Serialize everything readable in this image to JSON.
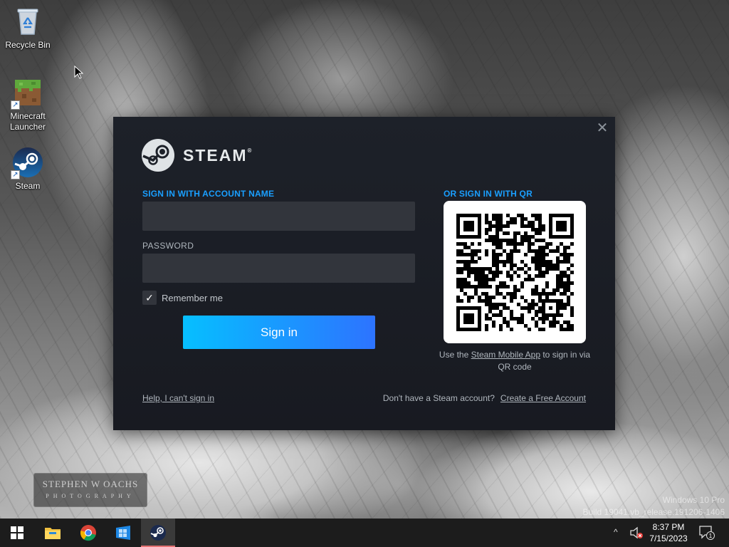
{
  "desktop": {
    "icons": [
      {
        "label": "Recycle Bin"
      },
      {
        "label": "Minecraft Launcher"
      },
      {
        "label": "Steam"
      }
    ],
    "photo_watermark": {
      "line1": "STEPHEN W OACHS",
      "line2": "PHOTOGRAPHY"
    },
    "windows_watermark": {
      "line1": "Windows 10 Pro",
      "line2": "Build 19041.vb_release.191206-1406"
    }
  },
  "steam_dialog": {
    "brand": "STEAM",
    "trademark": "®",
    "close_glyph": "✕",
    "account_label": "SIGN IN WITH ACCOUNT NAME",
    "account_value": "",
    "password_label": "PASSWORD",
    "password_value": "",
    "remember_label": "Remember me",
    "remember_checked": true,
    "signin_label": "Sign in",
    "qr_label": "OR SIGN IN WITH QR",
    "qr_caption_prefix": "Use the ",
    "qr_caption_link": "Steam Mobile App",
    "qr_caption_suffix": " to sign in via QR code",
    "help_link": "Help, I can't sign in",
    "no_account_text": "Don't have a Steam account?",
    "create_account_link": "Create a Free Account",
    "colors": {
      "accent": "#1a9fff",
      "button_start": "#06bfff",
      "button_end": "#2d73ff",
      "bg": "#181a21"
    }
  },
  "taskbar": {
    "items": [
      "start-icon",
      "file-explorer-icon",
      "chrome-icon",
      "windows-store-icon",
      "steam-icon"
    ],
    "active_item": "steam-icon",
    "tray_chevron": "^",
    "time": "8:37 PM",
    "date": "7/15/2023",
    "notification_count": "1"
  }
}
